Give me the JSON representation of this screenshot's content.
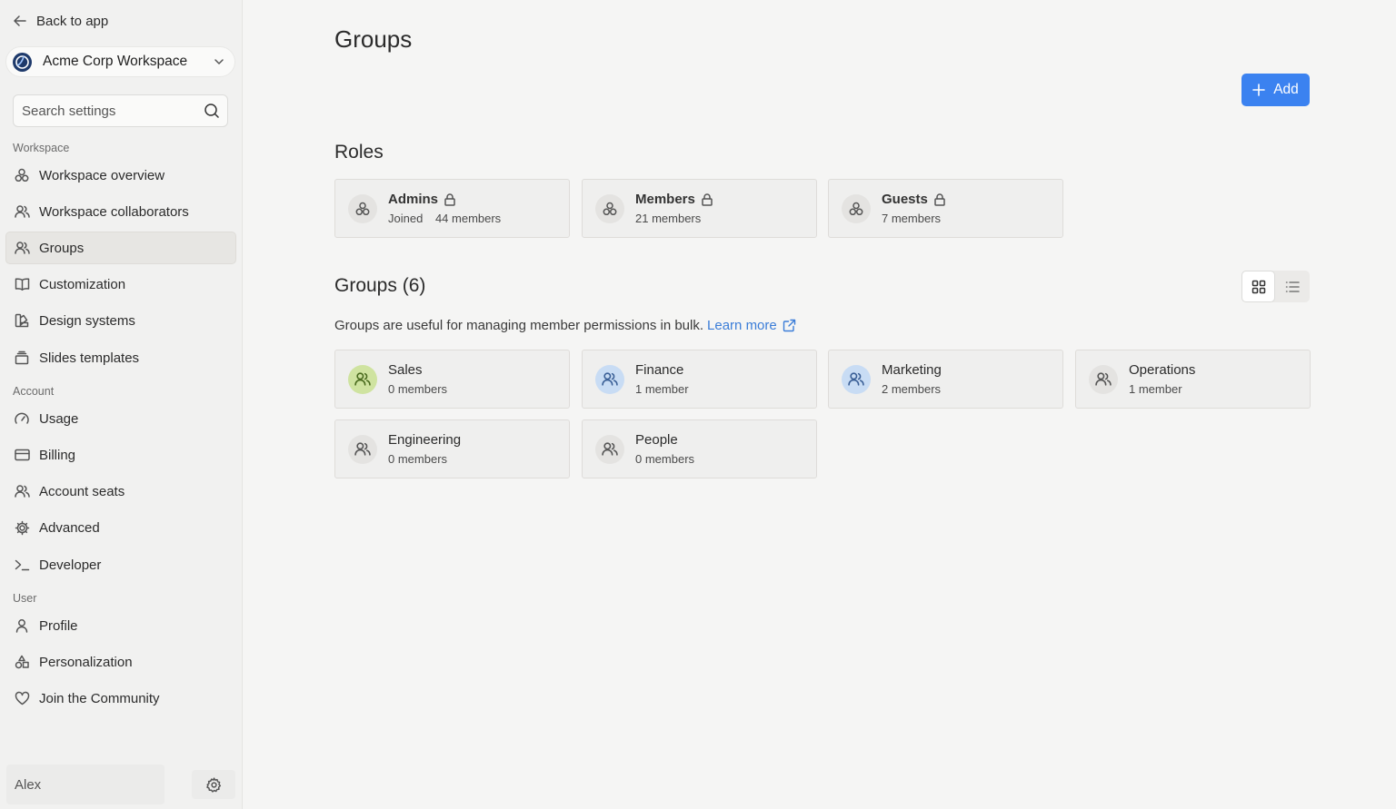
{
  "sidebar": {
    "back_label": "Back to app",
    "workspace_name": "Acme Corp Workspace",
    "search_placeholder": "Search settings",
    "sections": {
      "workspace": "Workspace",
      "account": "Account",
      "user": "User"
    },
    "items": {
      "workspace_overview": "Workspace overview",
      "workspace_collaborators": "Workspace collaborators",
      "groups": "Groups",
      "customization": "Customization",
      "design_systems": "Design systems",
      "slides_templates": "Slides templates",
      "usage": "Usage",
      "billing": "Billing",
      "account_seats": "Account seats",
      "advanced": "Advanced",
      "developer": "Developer",
      "profile": "Profile",
      "personalization": "Personalization",
      "join_community": "Join the Community"
    },
    "active_item": "groups",
    "user_name": "Alex"
  },
  "main": {
    "title": "Groups",
    "add_label": "Add",
    "roles_heading": "Roles",
    "roles": [
      {
        "name": "Admins",
        "joined": "Joined",
        "members": "44 members"
      },
      {
        "name": "Members",
        "members": "21 members"
      },
      {
        "name": "Guests",
        "members": "7 members"
      }
    ],
    "groups_heading": "Groups (6)",
    "groups_description": "Groups are useful for managing member permissions in bulk.",
    "learn_more": "Learn more",
    "view_mode": "grid",
    "groups": [
      {
        "name": "Sales",
        "members": "0 members",
        "avatar_color": "#cfe3a0",
        "icon_color": "#4a6b1e"
      },
      {
        "name": "Finance",
        "members": "1 member",
        "avatar_color": "#c8dcf4",
        "icon_color": "#3a5f96"
      },
      {
        "name": "Marketing",
        "members": "2 members",
        "avatar_color": "#c8dcf4",
        "icon_color": "#3a5f96"
      },
      {
        "name": "Operations",
        "members": "1 member",
        "avatar_color": "#e4e3e1",
        "icon_color": "#555555"
      },
      {
        "name": "Engineering",
        "members": "0 members",
        "avatar_color": "#e4e3e1",
        "icon_color": "#555555"
      },
      {
        "name": "People",
        "members": "0 members",
        "avatar_color": "#e4e3e1",
        "icon_color": "#555555"
      }
    ]
  },
  "colors": {
    "accent": "#3b82f0",
    "link": "#3b7dd8",
    "background": "#f5f5f4",
    "sidebar": "#f1f1f0"
  }
}
